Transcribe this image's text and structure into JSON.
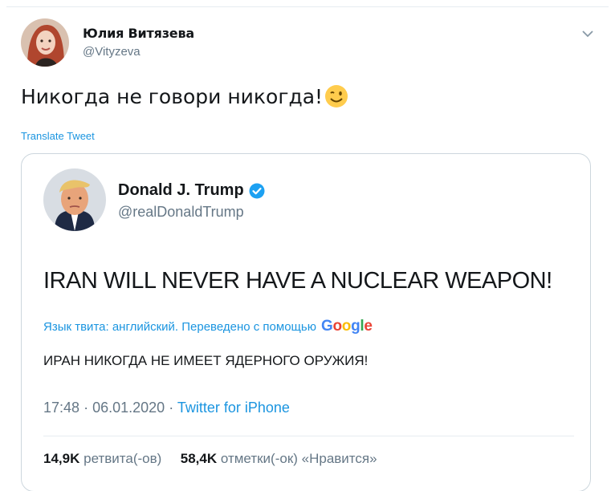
{
  "tweet": {
    "author_name": "Юлия Витязева",
    "author_handle": "@Vityzeva",
    "text": "Никогда не говори никогда!",
    "emoji": "winking-face",
    "translate_label": "Translate Tweet"
  },
  "quoted": {
    "author_name": "Donald J. Trump",
    "author_handle": "@realDonaldTrump",
    "verified": true,
    "text": "IRAN WILL NEVER HAVE A NUCLEAR WEAPON!",
    "translated_by_label": "Язык твита: английский. Переведено с помощью",
    "translator": "Google",
    "translation": "ИРАН НИКОГДА НЕ ИМЕЕТ ЯДЕРНОГО ОРУЖИЯ!",
    "time": "17:48",
    "separator": "·",
    "date": "06.01.2020",
    "source": "Twitter for iPhone",
    "retweets_count": "14,9K",
    "retweets_label": "ретвита(-ов)",
    "likes_count": "58,4K",
    "likes_label": "отметки(-ок) «Нравится»"
  },
  "colors": {
    "link": "#1b95e0",
    "secondary_text": "#657786",
    "border": "#ccd6dd",
    "verified": "#1da1f2"
  }
}
